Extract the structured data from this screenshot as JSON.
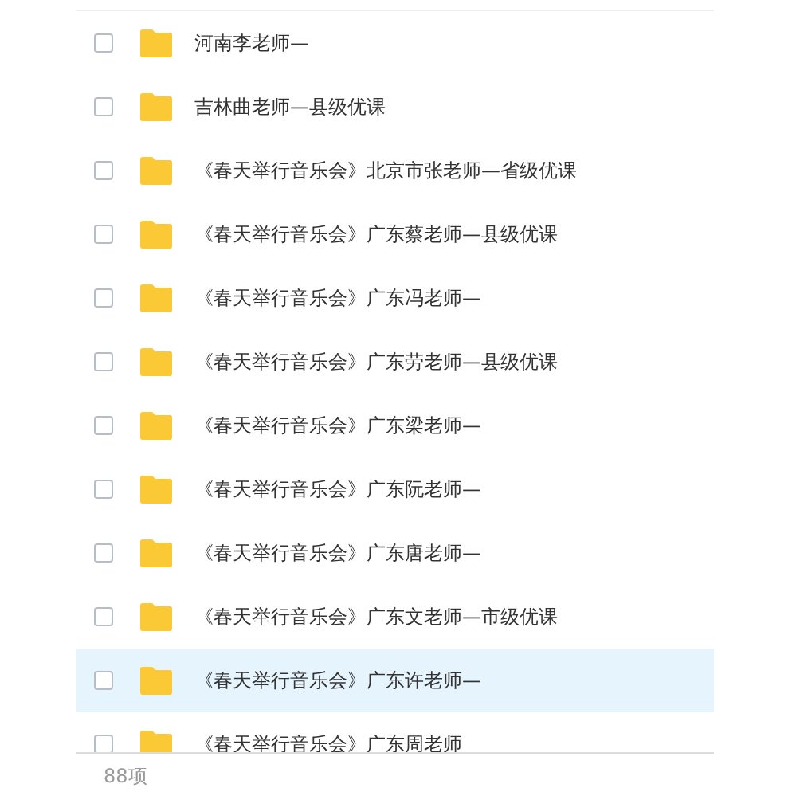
{
  "files": [
    {
      "name": "河南李老师—",
      "selected": false,
      "checked": false
    },
    {
      "name": "吉林曲老师—县级优课",
      "selected": false,
      "checked": false
    },
    {
      "name": "《春天举行音乐会》北京市张老师—省级优课",
      "selected": false,
      "checked": false
    },
    {
      "name": "《春天举行音乐会》广东蔡老师—县级优课",
      "selected": false,
      "checked": false
    },
    {
      "name": "《春天举行音乐会》广东冯老师—",
      "selected": false,
      "checked": false
    },
    {
      "name": "《春天举行音乐会》广东劳老师—县级优课",
      "selected": false,
      "checked": false
    },
    {
      "name": "《春天举行音乐会》广东梁老师—",
      "selected": false,
      "checked": false
    },
    {
      "name": "《春天举行音乐会》广东阮老师—",
      "selected": false,
      "checked": false
    },
    {
      "name": "《春天举行音乐会》广东唐老师—",
      "selected": false,
      "checked": false
    },
    {
      "name": "《春天举行音乐会》广东文老师—市级优课",
      "selected": false,
      "checked": false
    },
    {
      "name": "《春天举行音乐会》广东许老师—",
      "selected": true,
      "checked": false
    },
    {
      "name": "《春天举行音乐会》广东周老师",
      "selected": false,
      "checked": false
    }
  ],
  "status_bar": {
    "count": "88项"
  }
}
